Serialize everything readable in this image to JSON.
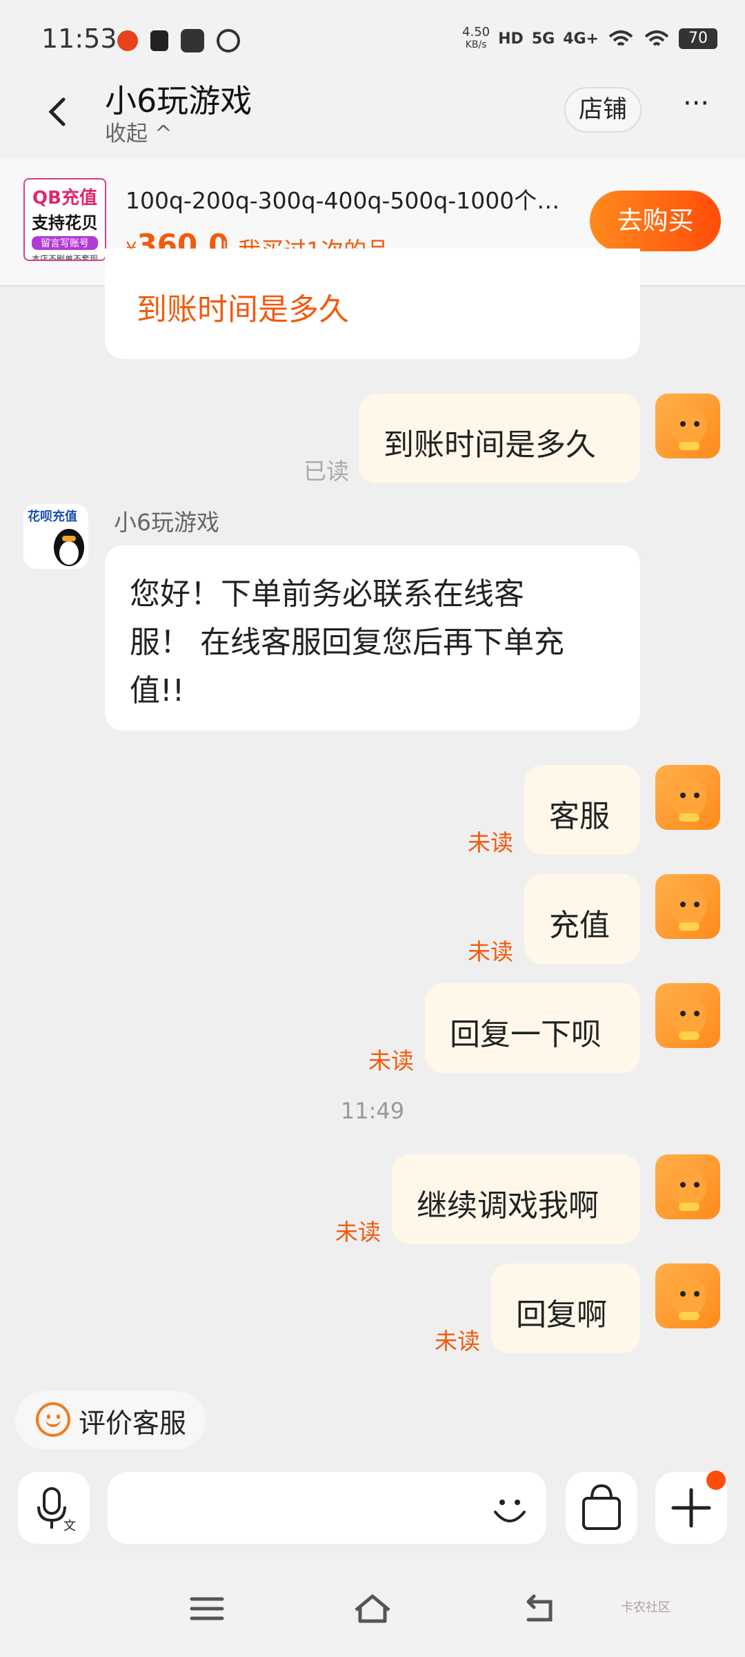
{
  "status_bar": {
    "time": "11:53",
    "speed_top": "4.50",
    "speed_unit": "KB/s",
    "net1": "HD",
    "net2": "5G",
    "net3": "4G+",
    "battery": "70"
  },
  "header": {
    "title": "小6玩游戏",
    "collapse": "收起 ^",
    "shop_button": "店铺",
    "more": "···"
  },
  "product": {
    "image_text": [
      "QB充值",
      "支持花贝",
      "留言写账号",
      "本店不刷单不套现"
    ],
    "title": "100q-200q-300q-400q-500q-1000个Q...",
    "currency": "¥",
    "price": "360.0",
    "bought": "我买过1次的品",
    "buy_button": "去购买"
  },
  "messages": {
    "partial_top": "到账时间是多久",
    "m1": "到账时间是多久",
    "m1_status": "已读",
    "seller_name": "小6玩游戏",
    "seller_avatar_text": "花呗充值",
    "seller_msg_l1": "您好！下单前务必联系在线客",
    "seller_msg_l2": "服！ 在线客服回复您后再下单充",
    "seller_msg_l3": "值!!",
    "m2": "客服",
    "m3": "充值",
    "m4": "回复一下呗",
    "time": "11:49",
    "m5": "继续调戏我啊",
    "m6": "回复啊",
    "unread": "未读"
  },
  "rate": {
    "label": "评价客服"
  },
  "input": {
    "placeholder": ""
  },
  "watermark": "卡农社区"
}
